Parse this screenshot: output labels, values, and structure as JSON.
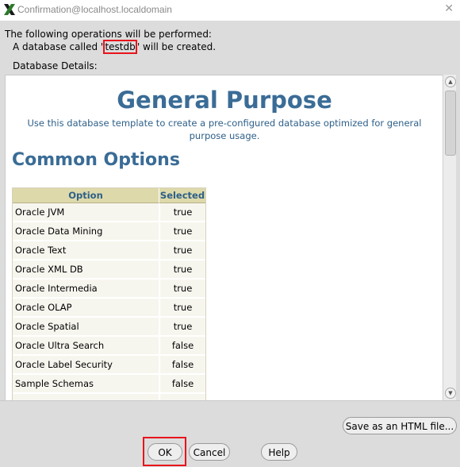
{
  "window": {
    "title": "Confirmation@localhost.localdomain",
    "close_glyph": "✕"
  },
  "operations": {
    "intro": "The following operations will be performed:",
    "db_prefix": "A database called \"",
    "db_name": "testdb",
    "db_suffix": "\" will be created.",
    "details_label": "Database Details:"
  },
  "template": {
    "title": "General Purpose",
    "description": "Use this database template to create a pre-configured database optimized for general purpose usage.",
    "section_title": "Common Options",
    "columns": [
      "Option",
      "Selected"
    ],
    "rows": [
      {
        "option": "Oracle JVM",
        "selected": "true"
      },
      {
        "option": "Oracle Data Mining",
        "selected": "true"
      },
      {
        "option": "Oracle Text",
        "selected": "true"
      },
      {
        "option": "Oracle XML DB",
        "selected": "true"
      },
      {
        "option": "Oracle Intermedia",
        "selected": "true"
      },
      {
        "option": "Oracle OLAP",
        "selected": "true"
      },
      {
        "option": "Oracle Spatial",
        "selected": "true"
      },
      {
        "option": "Oracle Ultra Search",
        "selected": "false"
      },
      {
        "option": "Oracle Label Security",
        "selected": "false"
      },
      {
        "option": "Sample Schemas",
        "selected": "false"
      },
      {
        "option": "",
        "selected": ""
      }
    ]
  },
  "buttons": {
    "save_html": "Save as an HTML file...",
    "ok": "OK",
    "cancel": "Cancel",
    "help": "Help"
  },
  "colors": {
    "accent": "#3a6c96",
    "table_header": "#ddd9ab",
    "highlight": "#e8141b"
  }
}
